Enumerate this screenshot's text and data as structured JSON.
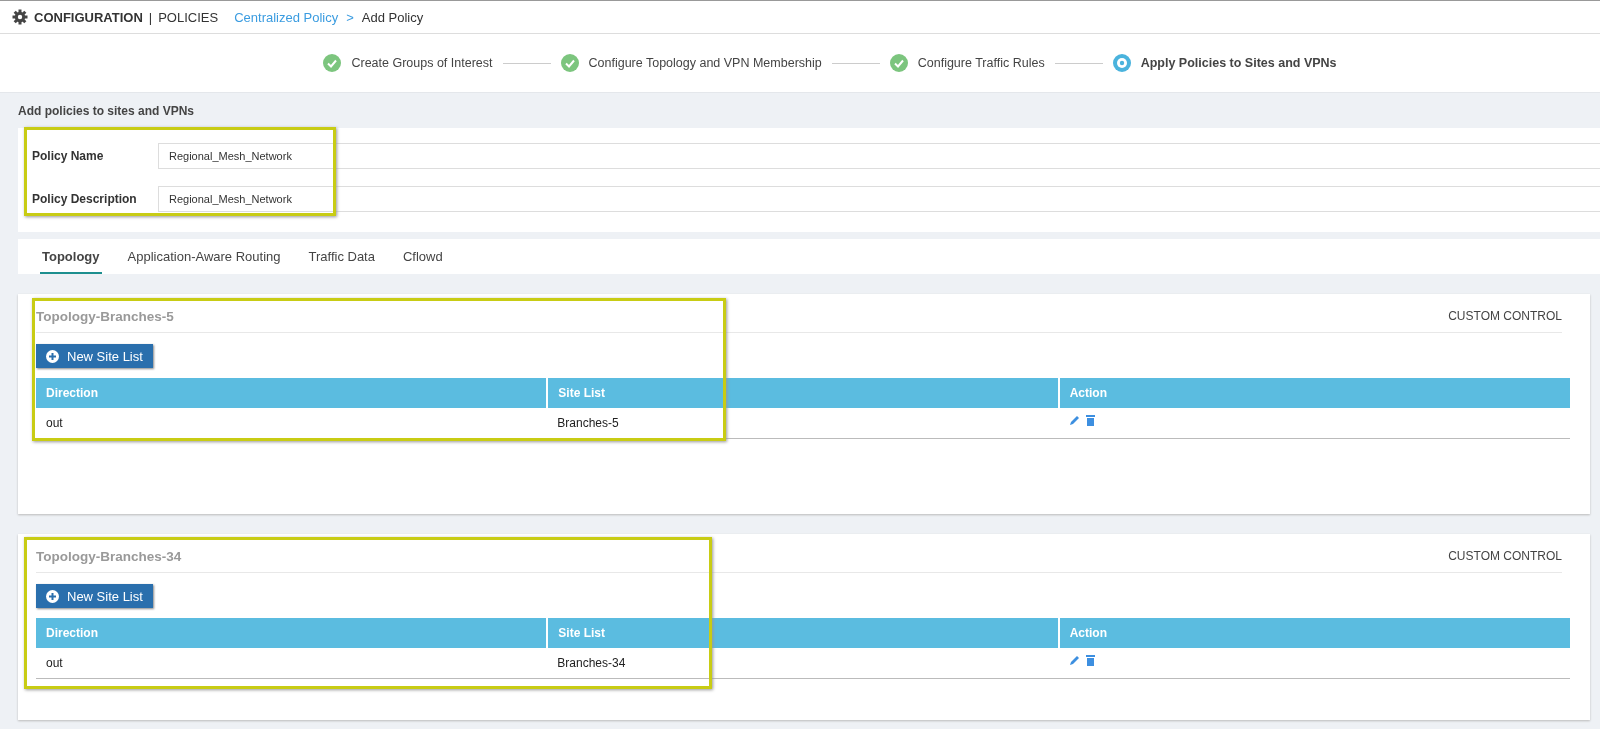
{
  "header": {
    "title": "CONFIGURATION",
    "divider": "|",
    "subtitle": "POLICIES",
    "breadcrumb": [
      {
        "label": "Centralized Policy",
        "kind": "link"
      },
      {
        "label": "Add Policy",
        "kind": "current"
      }
    ],
    "separator": ">"
  },
  "steps": [
    {
      "label": "Create Groups of Interest",
      "completed": true
    },
    {
      "label": "Configure Topology and VPN Membership",
      "completed": true
    },
    {
      "label": "Configure Traffic Rules",
      "completed": true
    },
    {
      "label": "Apply Policies to Sites and VPNs",
      "completed": false
    }
  ],
  "section_title": "Add policies to sites and VPNs",
  "form": [
    {
      "label": "Policy Name",
      "value": "Regional_Mesh_Network"
    },
    {
      "label": "Policy Description",
      "value": "Regional_Mesh_Network"
    }
  ],
  "tabs": [
    {
      "label": "Topology",
      "selected": true
    },
    {
      "label": "Application-Aware Routing",
      "selected": false
    },
    {
      "label": "Traffic Data",
      "selected": false
    },
    {
      "label": "Cflowd",
      "selected": false
    }
  ],
  "policies": [
    {
      "title": "Topology-Branches-5",
      "control": "CUSTOM CONTROL",
      "button": "New Site List",
      "columns": [
        "Direction",
        "Site List",
        "Action"
      ],
      "rows": [
        {
          "direction": "out",
          "site_list": "Branches-5"
        }
      ]
    },
    {
      "title": "Topology-Branches-34",
      "control": "CUSTOM CONTROL",
      "button": "New Site List",
      "columns": [
        "Direction",
        "Site List",
        "Action"
      ],
      "rows": [
        {
          "direction": "out",
          "site_list": "Branches-34"
        }
      ]
    }
  ]
}
